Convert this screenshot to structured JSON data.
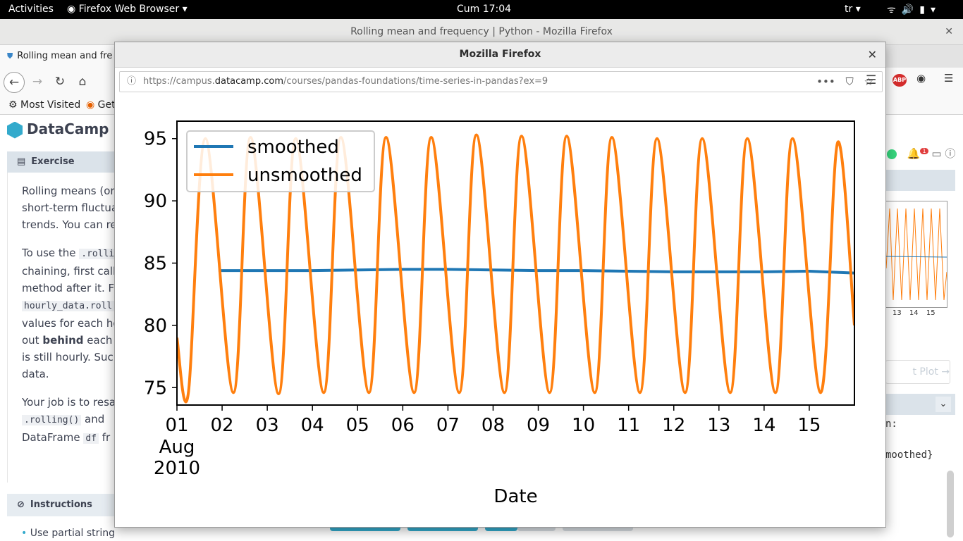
{
  "topbar": {
    "activities": "Activities",
    "app_name": "Firefox Web Browser",
    "clock": "Cum 17:04",
    "lang": "tr"
  },
  "firefox": {
    "window_title": "Rolling mean and frequency | Python - Mozilla Firefox",
    "tab_title": "Rolling mean and fre",
    "bookmark_most_visited": "Most Visited",
    "bookmark_get": "Get"
  },
  "page": {
    "brand": "DataCamp",
    "exercise_label": "Exercise",
    "instructions_label": "Instructions",
    "instructions_first": "Use partial string",
    "para1": [
      "Rolling means (or m",
      "short-term fluctuat",
      "trends. You can reac"
    ],
    "para2_line1_pre": "To use the ",
    "para2_line1_code": ".rolli",
    "para2_lines": [
      "chaining, first calling",
      "method after it. For"
    ],
    "para2_code2": "hourly_data.roll",
    "para2_lines_b": [
      "values for each hou"
    ],
    "para2_out": "out ",
    "para2_behind": "behind",
    "para2_out_rest": " each po",
    "para2_lines_c": [
      "is still hourly. Such a",
      "data."
    ],
    "para3_line1": "Your job is to resam",
    "para3_code1": ".rolling()",
    "para3_and": " and",
    "para3_df_pre": "DataFrame ",
    "para3_code2": "df",
    "para3_fr": " fr",
    "plot_button": "t Plot →",
    "console_lines": [
      "n:",
      "",
      "moothed}"
    ],
    "mini_ticks": [
      "13",
      "14",
      "15"
    ],
    "notification_count": "1"
  },
  "dialog": {
    "title": "Mozilla Firefox",
    "url_prefix": "https://campus.",
    "url_domain": "datacamp.com",
    "url_rest": "/courses/pandas-foundations/time-series-in-pandas?ex=9"
  },
  "chart_data": {
    "type": "line",
    "xlabel": "Date",
    "x_ticks": [
      "01",
      "02",
      "03",
      "04",
      "05",
      "06",
      "07",
      "08",
      "09",
      "10",
      "11",
      "12",
      "13",
      "14",
      "15"
    ],
    "x_first_sub": [
      "Aug",
      "2010"
    ],
    "y_ticks": [
      75,
      80,
      85,
      90,
      95
    ],
    "ylim": [
      73.6,
      96.4
    ],
    "xlim_days": [
      0,
      15
    ],
    "legend_position": "upper-left",
    "series": [
      {
        "name": "smoothed",
        "color": "#1f77b4",
        "x": [
          0.92,
          2,
          3,
          4,
          5,
          6,
          7,
          8,
          9,
          10,
          11,
          12,
          13,
          14,
          15
        ],
        "values": [
          84.4,
          84.4,
          84.4,
          84.45,
          84.5,
          84.5,
          84.45,
          84.4,
          84.4,
          84.35,
          84.3,
          84.3,
          84.3,
          84.35,
          84.2
        ]
      },
      {
        "name": "unsmoothed",
        "color": "#ff7f0e",
        "x": [
          0,
          0.25,
          0.63,
          1.25,
          1.63,
          2.25,
          2.63,
          3.25,
          3.63,
          4.25,
          4.63,
          5.25,
          5.63,
          6.25,
          6.63,
          7.25,
          7.63,
          8.25,
          8.63,
          9.25,
          9.63,
          10.25,
          10.63,
          11.25,
          11.63,
          12.25,
          12.63,
          13.25,
          13.63,
          14.25,
          14.63,
          15
        ],
        "values": [
          79,
          74.5,
          95,
          74.6,
          95.1,
          74.5,
          95,
          74.6,
          95.1,
          74.6,
          95.1,
          74.6,
          95.1,
          74.6,
          95.3,
          74.6,
          95.2,
          74.6,
          95.2,
          74.6,
          95.1,
          74.6,
          95.0,
          74.6,
          95.0,
          74.6,
          95.0,
          74.6,
          95.0,
          74.6,
          94.7,
          80
        ]
      }
    ]
  }
}
